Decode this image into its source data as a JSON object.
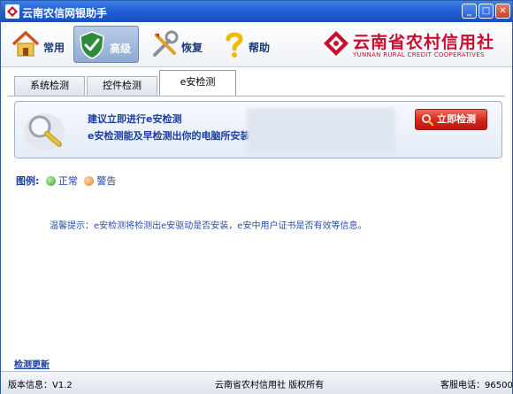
{
  "window": {
    "title": "云南农信网银助手"
  },
  "window_controls": {
    "minimize": "_",
    "maximize": "□",
    "close": "✕"
  },
  "toolbar": {
    "items": [
      {
        "label": "常用",
        "icon": "house-icon"
      },
      {
        "label": "高级",
        "icon": "shield-check-icon",
        "selected": true
      },
      {
        "label": "恢复",
        "icon": "tools-icon"
      },
      {
        "label": "帮助",
        "icon": "question-mark-icon"
      }
    ]
  },
  "brand": {
    "name_cn": "云南省农村信用社",
    "name_en": "YUNNAN RURAL CREDIT COOPERATIVES"
  },
  "tabs": [
    {
      "label": "系统检测"
    },
    {
      "label": "控件检测"
    },
    {
      "label": "e安检测",
      "active": true
    }
  ],
  "panel": {
    "line1": "建议立即进行e安检测",
    "line2": "e安检测能及早检测出你的电脑所安装的",
    "button": "立即检测"
  },
  "legend": {
    "title": "图例:",
    "ok": "正常",
    "warn": "警告"
  },
  "tip": "温馨提示：e安检测将检测出e安驱动是否安装，e安中用户证书是否有效等信息。",
  "update_link": "检测更新",
  "status": {
    "version": "版本信息：V1.2",
    "copyright": "云南省农村信用社 版权所有",
    "phone": "客服电话：96500"
  },
  "colors": {
    "accent_blue": "#1a3fa0",
    "brand_red": "#c8102e",
    "titlebar": "#1f5cd2"
  }
}
